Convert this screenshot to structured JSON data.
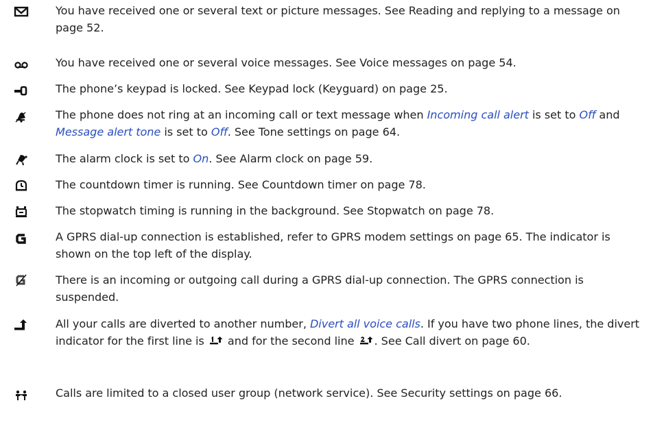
{
  "entries": [
    {
      "icon": "envelope-message-icon",
      "text": "You have received one or several text or picture messages. See Reading and replying to a message on page 52."
    },
    {
      "icon": "voicemail-icon",
      "text": "You have received one or several voice messages. See Voice messages on page 54."
    },
    {
      "icon": "keypad-lock-icon",
      "text": "The phone’s keypad is locked. See Keypad lock (Keyguard) on page 25."
    },
    {
      "icon": "silent-bell-icon",
      "parts": {
        "a": "The phone does not ring at an incoming call or text message when ",
        "link1": "Incoming call alert",
        "b": " is set to ",
        "link2": "Off",
        "c": " and ",
        "link3": "Message alert tone",
        "d": " is set to ",
        "link4": "Off",
        "e": ". See Tone settings on page 64."
      }
    },
    {
      "icon": "alarm-clock-icon",
      "parts": {
        "a": "The alarm clock is set to ",
        "link1": "On",
        "b": ". See Alarm clock on page 59."
      }
    },
    {
      "icon": "countdown-timer-icon",
      "text": "The countdown timer is running. See Countdown timer on page 78."
    },
    {
      "icon": "stopwatch-icon",
      "text": "The stopwatch timing is running in the background. See Stopwatch on page 78."
    },
    {
      "icon": "gprs-connection-icon",
      "text": "A GPRS dial-up connection is established, refer to GPRS modem settings on page 65. The indicator is shown on the top left of the display."
    },
    {
      "icon": "gprs-suspended-icon",
      "text": "There is an incoming or outgoing call during a GPRS dial-up connection. The GPRS connection is suspended."
    },
    {
      "icon": "call-divert-icon",
      "parts": {
        "a": "All your calls are diverted to another number, ",
        "link1": "Divert all voice calls",
        "b": ". If you have two phone lines, the divert indicator for the first line is ",
        "c": " and for the second line ",
        "d": ". See Call divert on page 60."
      },
      "inline_icons": [
        "divert-line-1-icon",
        "divert-line-2-icon"
      ]
    },
    {
      "icon": "closed-user-group-icon",
      "text": "Calls are limited to a closed user group (network service). See Security settings on page 66."
    }
  ]
}
